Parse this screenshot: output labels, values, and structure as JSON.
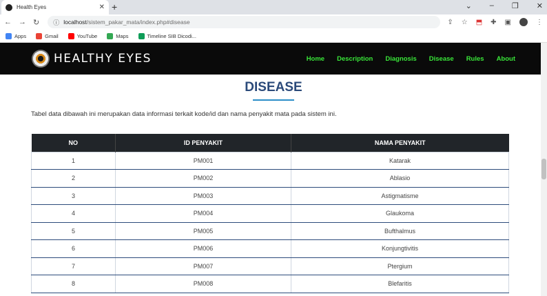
{
  "browser": {
    "tab_title": "Health Eyes",
    "new_tab": "+",
    "url_host": "localhost",
    "url_path": "/sistem_pakar_mata/index.php#disease",
    "bookmarks": [
      {
        "label": "Apps",
        "color": "#4285f4"
      },
      {
        "label": "Gmail",
        "color": "#ea4335"
      },
      {
        "label": "YouTube",
        "color": "#ff0000"
      },
      {
        "label": "Maps",
        "color": "#34a853"
      },
      {
        "label": "Timeline SIB Dicodi...",
        "color": "#0f9d58"
      }
    ]
  },
  "site": {
    "brand": "HEALTHY EYES",
    "nav": [
      "Home",
      "Description",
      "Diagnosis",
      "Disease",
      "Rules",
      "About"
    ]
  },
  "section": {
    "title": "DISEASE",
    "intro": "Tabel data dibawah ini merupakan data informasi terkait kode/id dan nama penyakit mata pada sistem ini."
  },
  "table": {
    "headers": [
      "NO",
      "ID PENYAKIT",
      "NAMA PENYAKIT"
    ],
    "rows": [
      [
        "1",
        "PM001",
        "Katarak"
      ],
      [
        "2",
        "PM002",
        "Ablasio"
      ],
      [
        "3",
        "PM003",
        "Astigmatisme"
      ],
      [
        "4",
        "PM004",
        "Glaukoma"
      ],
      [
        "5",
        "PM005",
        "Bufthalmus"
      ],
      [
        "6",
        "PM006",
        "Konjungtivitis"
      ],
      [
        "7",
        "PM007",
        "Ptergium"
      ],
      [
        "8",
        "PM008",
        "Blefaritis"
      ]
    ]
  },
  "colors": {
    "nav_link": "#39e639",
    "title": "#2b4a7a",
    "header_bg": "#212529"
  }
}
